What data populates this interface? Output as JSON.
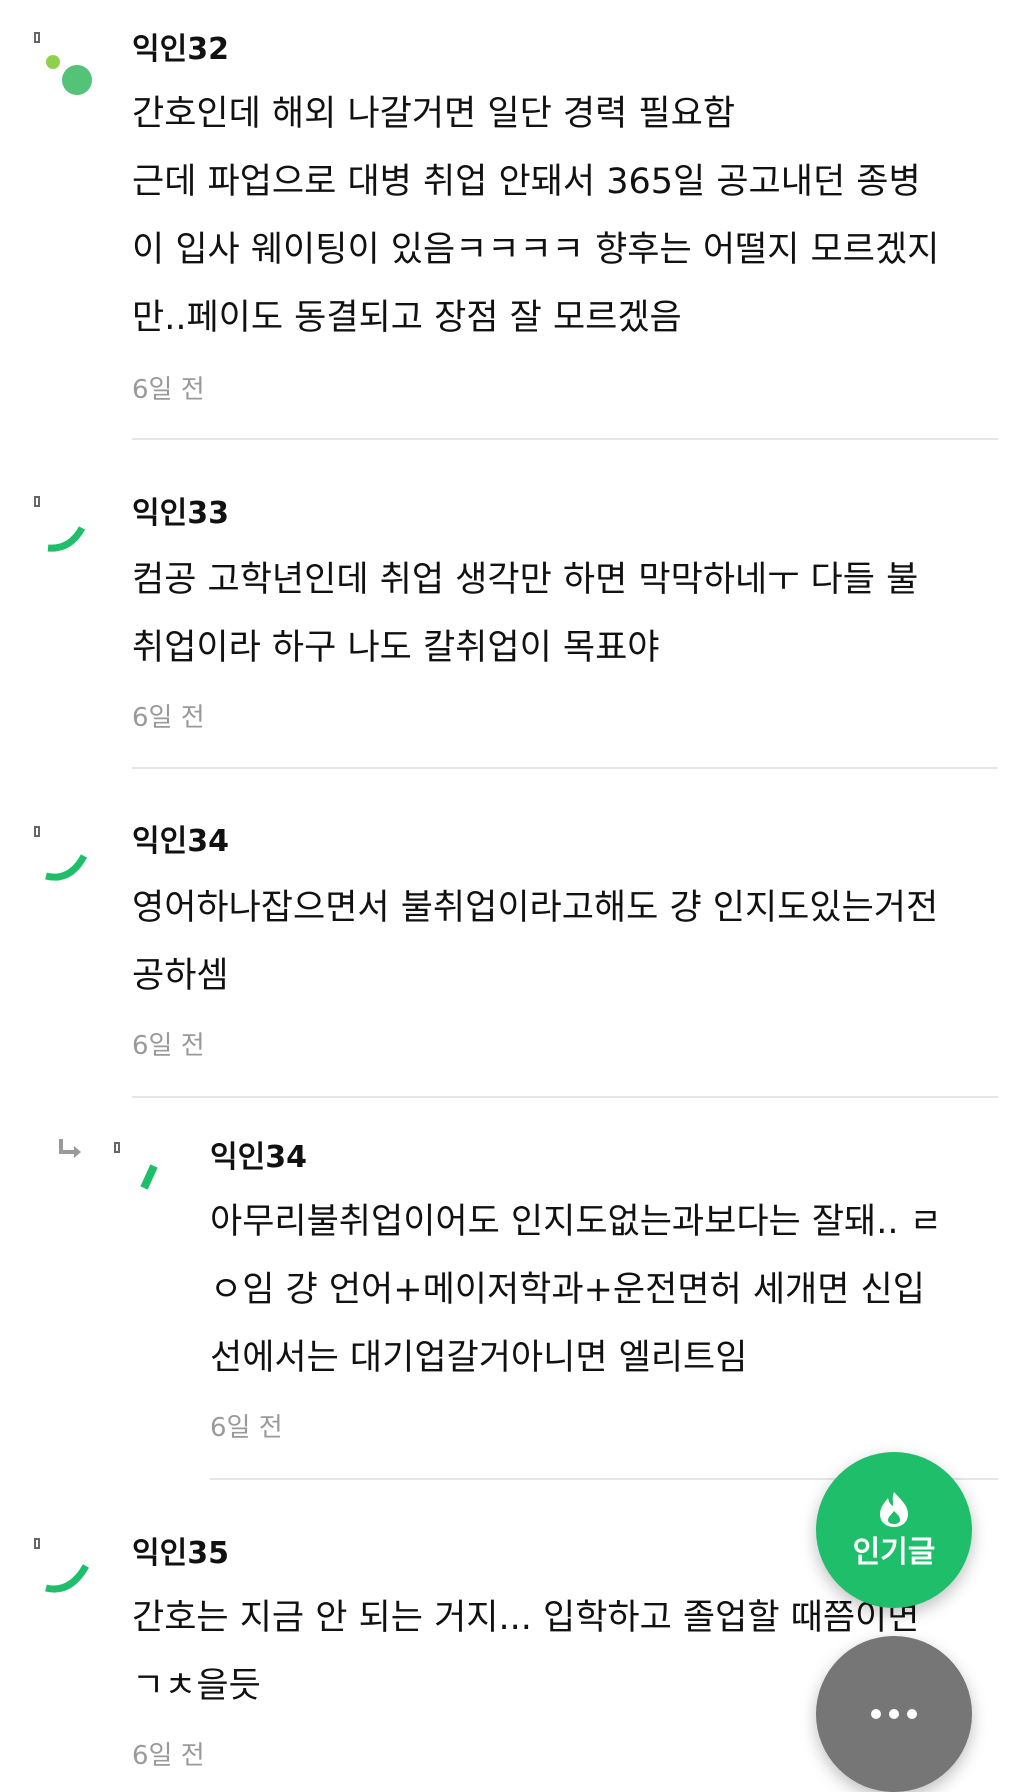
{
  "comments": [
    {
      "author": "익인32",
      "text": "간호인데 해외 나갈거면 일단 경력 필요함\n근데 파업으로 대병 취업 안돼서 365일 공고내던 종병\n이 입사 웨이팅이 있음ㅋㅋㅋㅋ 향후는 어떨지 모르겠지\n만..페이도 동결되고 장점 잘 모르겠음",
      "time": "6일 전"
    },
    {
      "author": "익인33",
      "text": "컴공 고학년인데 취업 생각만 하면 막막하네ㅜ 다들 불\n취업이라 하구 나도 칼취업이 목표야",
      "time": "6일 전"
    },
    {
      "author": "익인34",
      "text": "영어하나잡으면서 불취업이라고해도 걍 인지도있는거전\n공하셈",
      "time": "6일 전"
    },
    {
      "author": "익인34",
      "text": "아무리불취업이어도 인지도없는과보다는 잘돼.. ㄹ\nㅇ임 걍 언어+메이저학과+운전면허 세개면 신입\n선에서는 대기업갈거아니면 엘리트임",
      "time": "6일 전"
    },
    {
      "author": "익인35",
      "text": "간호는 지금 안 되는 거지... 입학하고 졸업할 때쯤이면\nㄱㅊ을듯",
      "time": "6일 전"
    }
  ],
  "fab": {
    "popular_label": "인기글",
    "icons": {
      "popular": "flame-icon",
      "more": "more-dots-icon",
      "reply": "reply-arrow-icon"
    }
  },
  "colors": {
    "accent": "#1fbe6a",
    "fab_more": "#767676",
    "time": "#9a9a9a",
    "divider": "#e6e6e6"
  }
}
